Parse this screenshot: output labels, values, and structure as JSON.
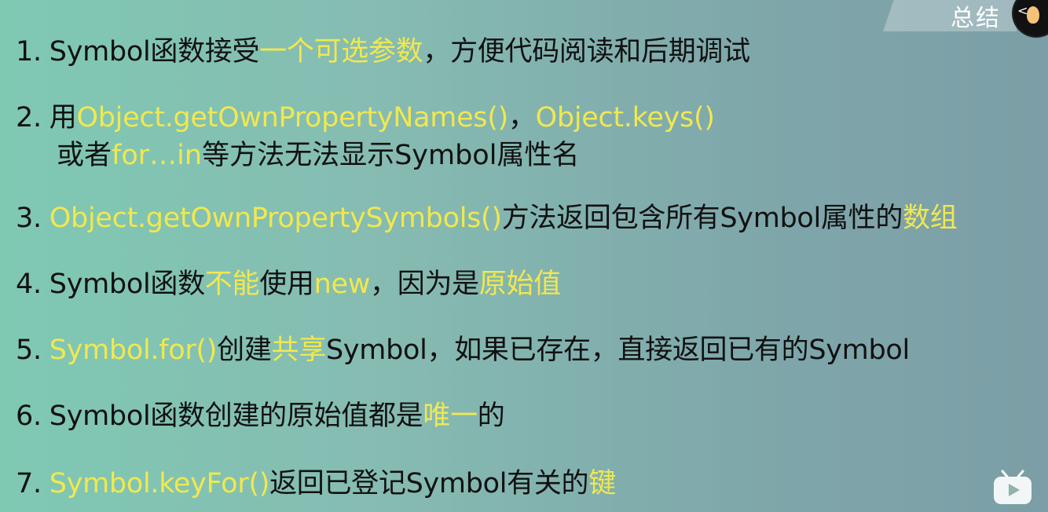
{
  "header": {
    "tag": "总结"
  },
  "items": [
    {
      "num": "1.",
      "segments": [
        {
          "t": "Symbol函数接受",
          "hl": false
        },
        {
          "t": "一个可选参数",
          "hl": true
        },
        {
          "t": "，方便代码阅读和后期调试",
          "hl": false
        }
      ]
    },
    {
      "num": "2.",
      "segments": [
        {
          "t": "用",
          "hl": false
        },
        {
          "t": "Object.getOwnPropertyNames()",
          "hl": true
        },
        {
          "t": "，",
          "hl": false
        },
        {
          "t": "Object.keys()",
          "hl": true
        }
      ],
      "cont": [
        {
          "t": "或者",
          "hl": false
        },
        {
          "t": "for…in",
          "hl": true
        },
        {
          "t": "等方法无法显示Symbol属性名",
          "hl": false
        }
      ]
    },
    {
      "num": "3.",
      "segments": [
        {
          "t": "Object.getOwnPropertySymbols()",
          "hl": true
        },
        {
          "t": "方法返回包含所有Symbol属性的",
          "hl": false
        },
        {
          "t": "数组",
          "hl": true
        }
      ]
    },
    {
      "num": "4.",
      "segments": [
        {
          "t": "Symbol函数",
          "hl": false
        },
        {
          "t": "不能",
          "hl": true
        },
        {
          "t": "使用",
          "hl": false
        },
        {
          "t": "new",
          "hl": true
        },
        {
          "t": "，因为是",
          "hl": false
        },
        {
          "t": "原始值",
          "hl": true
        }
      ]
    },
    {
      "num": "5.",
      "segments": [
        {
          "t": "Symbol.for()",
          "hl": true
        },
        {
          "t": "创建",
          "hl": false
        },
        {
          "t": "共享",
          "hl": true
        },
        {
          "t": "Symbol，如果已存在，直接返回已有的Symbol",
          "hl": false
        }
      ]
    },
    {
      "num": "6.",
      "segments": [
        {
          "t": "Symbol函数创建的原始值都是",
          "hl": false
        },
        {
          "t": "唯一",
          "hl": true
        },
        {
          "t": "的",
          "hl": false
        }
      ]
    },
    {
      "num": "7.",
      "segments": [
        {
          "t": "Symbol.keyFor()",
          "hl": true
        },
        {
          "t": "返回已登记Symbol有关的",
          "hl": false
        },
        {
          "t": "键",
          "hl": true
        }
      ]
    }
  ],
  "colors": {
    "highlight": "#f1e84f",
    "text": "#111111"
  },
  "icons": {
    "corner": "avatar-icon",
    "player": "bilibili-tv-icon"
  }
}
